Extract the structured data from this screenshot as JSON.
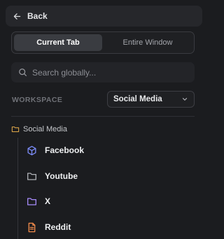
{
  "nav": {
    "back_label": "Back",
    "back_icon": "arrow-left-icon"
  },
  "view_toggle": {
    "options": [
      "Current Tab",
      "Entire Window"
    ],
    "selected": "Current Tab"
  },
  "search": {
    "placeholder": "Search globally...",
    "value": "",
    "icon": "search-icon"
  },
  "workspace": {
    "label": "WORKSPACE",
    "selected": "Social Media"
  },
  "folder": {
    "title": "Social Media",
    "items": [
      {
        "label": "Facebook",
        "icon": "cube-icon",
        "color": "#7c8cf8"
      },
      {
        "label": "Youtube",
        "icon": "folder-icon",
        "color": "#b0b2b7"
      },
      {
        "label": "X",
        "icon": "folder-icon",
        "color": "#a78bfa"
      },
      {
        "label": "Reddit",
        "icon": "document-icon",
        "color": "#f08a4b"
      }
    ]
  },
  "colors": {
    "background": "#1b1c1f",
    "folder_accent": "#e0a84a",
    "toggle_active": "#3a3c41"
  }
}
